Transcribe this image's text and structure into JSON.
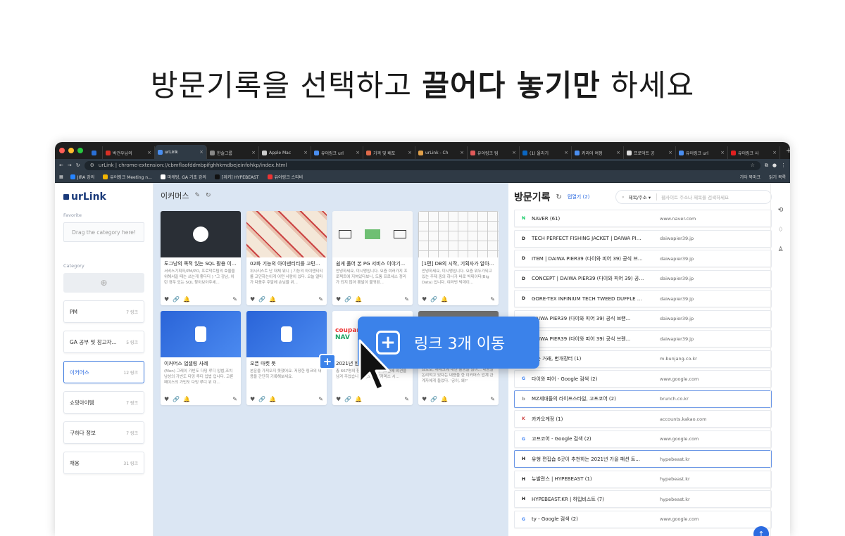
{
  "headline": {
    "part1": "방문기록을 선택하고 ",
    "bold": "끌어다 놓기만",
    "part2": " 하세요"
  },
  "browser": {
    "tabs": [
      {
        "label": "",
        "color": "#2a6fd6"
      },
      {
        "label": "박건우님의",
        "color": "#d93025"
      },
      {
        "label": "urLink",
        "color": "#4a8ef0",
        "active": true
      },
      {
        "label": "한솔그룹",
        "color": "#888"
      },
      {
        "label": "Apple Mac",
        "color": "#ccc"
      },
      {
        "label": "유어링크 url",
        "color": "#4a8ef0"
      },
      {
        "label": "가격 및 배포",
        "color": "#e06a4a"
      },
      {
        "label": "urLink - Ch",
        "color": "#e0a04a"
      },
      {
        "label": "유어링크 팀",
        "color": "#e05a5a"
      },
      {
        "label": "(1) 올리기",
        "color": "#0a66c2"
      },
      {
        "label": "커리어 여정",
        "color": "#4a8ef0"
      },
      {
        "label": "프로덕트 공",
        "color": "#ddd"
      },
      {
        "label": "유어링크 url",
        "color": "#4a8ef0"
      },
      {
        "label": "유어링크 사",
        "color": "#e02020"
      }
    ],
    "url": "urLink | chrome-extension://cbmflaofddmbpifghhkmdbejeinfohkp/index.html",
    "bookmarks": [
      {
        "label": "JIRA 강의",
        "color": "#2684ff"
      },
      {
        "label": "유어링크 Meeting n...",
        "color": "#f2b400"
      },
      {
        "label": "마케팅, GA 기초 강의",
        "color": "#fff"
      },
      {
        "label": "[위키] HYPEBEAST",
        "color": "#111"
      },
      {
        "label": "유어링크 스티비",
        "color": "#e33"
      }
    ],
    "bookmarks_right": [
      {
        "label": "기타 북마크"
      },
      {
        "label": "읽기 목록"
      }
    ]
  },
  "sidebar": {
    "logo": "urLink",
    "favorite_label": "Favorite",
    "drop_text": "Drag the category here!",
    "category_label": "Category",
    "categories": [
      {
        "name": "PM",
        "count": "7 링크"
      },
      {
        "name": "GA 공부 및 참고자...",
        "count": "5 링크"
      },
      {
        "name": "이커머스",
        "count": "12 링크",
        "selected": true
      },
      {
        "name": "쇼핑아이템",
        "count": "7 링크"
      },
      {
        "name": "구하다 정보",
        "count": "7 링크"
      },
      {
        "name": "채용",
        "count": "31 링크"
      }
    ]
  },
  "main": {
    "title": "이커머스",
    "cards": [
      {
        "title": "도그냥의 목적 있는 SQL 활용 이...",
        "desc": "서비스기획자/PM/PO, 프로덕트팀의 효율을 위해서일 때는 쓰는게 좋다더 ) \"그 강남, 이런 경우 있는 SQL 찾아보아주세...",
        "thumb": "dark"
      },
      {
        "title": "02화 기능의 아이덴티티를 고민...",
        "desc": "위시리스트 난 대체 뭐니 | 기능의 아이덴티티를 고민하는이게 어떤 사람이 있다. 오늘 얼마가 다음주 주말에 손님을 위...",
        "thumb": "fashion"
      },
      {
        "title": "쉽게 풀어 본 PG 서비스 이야기...",
        "desc": "안녕하세요, 미시맹입니다. 요즘 여러가지 프로젝트에 지쳐있다보니, 도통 프로세스 정리가 되지 않아 팬발이 불귀된...",
        "thumb": "diagram"
      },
      {
        "title": "[1편] DB의 시작, 기획자가 알아...",
        "desc": "안녕하세요, 미시맹입니다. 요즘 뭐두가되고 있는 주제 중의 하나가 바로 빅데이터(Big Data) 입니다. 여러번 빅데이...",
        "thumb": "diagram2"
      },
      {
        "title": "이커머스 업셀링 사례",
        "desc": "(Men) 그레이 가빈도 다밍 루디 입법,조치 남성의 가빈도 다밍 루디 입법 입니다. 고론 페이스의 가빈도 다밍 루디 위 이...",
        "thumb": "blue"
      },
      {
        "title": "오픈 마켓 뜻",
        "desc": "본문을 가져오지 못했어요. 저장한 링크의 내용을 간단히 기록해보세요.",
        "thumb": "blue2"
      },
      {
        "title": "2021년 한국...",
        "desc": "총 667명의 창업 분이 이커머스관에 의견을 남겨 주었습니다. 상되는 이커머스 시...",
        "thumb": "coupang"
      },
      {
        "title": "...",
        "desc": "요로보, 재테크에 대한 활동을 많이... 내용을 논리적고 있다는 내용을 한 이커머스 업계 관계자에게 들었다. '궁이, 왜?'",
        "thumb": "photo"
      }
    ]
  },
  "history": {
    "title": "방문기록",
    "open_tabs": "탭열기 (2)",
    "search_select": "제목/주소",
    "search_placeholder": "웹사이트 주소나 제목을 검색하세요",
    "items": [
      {
        "title": "NAVER (61)",
        "domain": "www.naver.com",
        "icon": "N",
        "icon_color": "#03c75a"
      },
      {
        "title": "TECH PERFECT FISHING JACKET | DAIWA PIER39...",
        "domain": "daiwapier39.jp",
        "icon": "D",
        "icon_color": "#222"
      },
      {
        "title": "ITEM | DAIWA PIER39 (다이와 피어 39) 공식 브랜...",
        "domain": "daiwapier39.jp",
        "icon": "D",
        "icon_color": "#222"
      },
      {
        "title": "CONCEPT | DAIWA PIER39 (다이와 피어 39) 공식 브...",
        "domain": "daiwapier39.jp",
        "icon": "D",
        "icon_color": "#222"
      },
      {
        "title": "GORE-TEX INFINIUM TECH TWEED DUFFLE CO...",
        "domain": "daiwapier39.jp",
        "icon": "D",
        "icon_color": "#222"
      },
      {
        "title": "DAIWA PIER39 (다이와 피어 39) 공식 브랜...",
        "domain": "daiwapier39.jp",
        "icon": "D",
        "icon_color": "#222"
      },
      {
        "title": "DAIWA PIER39 (다이와 피어 39) 공식 브랜...",
        "domain": "daiwapier39.jp",
        "icon": "D",
        "icon_color": "#222"
      },
      {
        "title": "있는 거래, 번개장터 (1)",
        "domain": "m.bunjang.co.kr",
        "icon": "⚡",
        "icon_color": "#d00"
      },
      {
        "title": "다이와 피어 - Google 검색 (2)",
        "domain": "www.google.com",
        "icon": "G",
        "icon_color": "#4285f4"
      },
      {
        "title": "MZ세대들의 라이프스타일, 고프코어 (2)",
        "domain": "brunch.co.kr",
        "icon": "b",
        "icon_color": "#888",
        "selected": true
      },
      {
        "title": "카카오계정 (1)",
        "domain": "accounts.kakao.com",
        "icon": "K",
        "icon_color": "#c44"
      },
      {
        "title": "고프코어 - Google 검색 (2)",
        "domain": "www.google.com",
        "icon": "G",
        "icon_color": "#4285f4"
      },
      {
        "title": "유행 편집숍 6곳이 추천하는 2021년 가을 패션 트...",
        "domain": "hypebeast.kr",
        "icon": "H",
        "icon_color": "#111",
        "selected": true
      },
      {
        "title": "뉴발란스 | HYPEBEAST (1)",
        "domain": "hypebeast.kr",
        "icon": "H",
        "icon_color": "#111"
      },
      {
        "title": "HYPEBEAST.KR | 하입비스트 (7)",
        "domain": "hypebeast.kr",
        "icon": "H",
        "icon_color": "#111"
      },
      {
        "title": "ty - Google 검색 (2)",
        "domain": "www.google.com",
        "icon": "G",
        "icon_color": "#4285f4"
      }
    ]
  },
  "drag_bubble": {
    "label": "링크 3개 이동"
  },
  "colors": {
    "accent": "#2c6be0",
    "main_bg": "#dbe6f3",
    "bubble": "#3b82ea"
  }
}
